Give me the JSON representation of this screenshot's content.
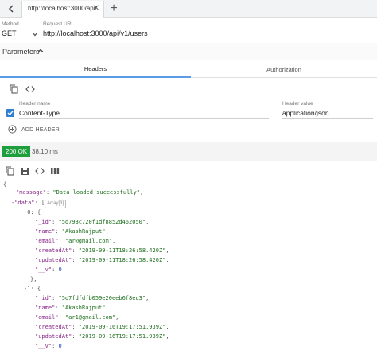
{
  "tab": {
    "title": "http://localhost:3000/api/..."
  },
  "request": {
    "method_label": "Method",
    "method": "GET",
    "url_label": "Request URL",
    "url": "http://localhost:3000/api/v1/users"
  },
  "parameters": {
    "label": "Parameters"
  },
  "subtabs": {
    "headers": "Headers",
    "authorization": "Authorization"
  },
  "headers_panel": {
    "name_label": "Header name",
    "value_label": "Header value",
    "rows": [
      {
        "name": "Content-Type",
        "value": "application/json",
        "enabled": true
      }
    ],
    "add_label": "ADD HEADER"
  },
  "response": {
    "status": "200 OK",
    "time": "38.10 ms",
    "json": {
      "open": "{",
      "message_key": "\"message\"",
      "message_value": "\"Data loaded successfully\"",
      "data_toggle": "-",
      "data_key": "\"data\"",
      "data_open": "[",
      "data_meta": "Array[3]",
      "items": [
        {
          "toggle": "-0:",
          "brace": "{",
          "id": "\"5d793c720f1df8852d462050\"",
          "name": "\"AkashRajput\"",
          "email": "\"ar@gmail.com\"",
          "createdAt": "\"2019-09-11T18:26:58.420Z\"",
          "updatedAt": "\"2019-09-11T18:26:58.420Z\"",
          "v": "0",
          "close": "},"
        },
        {
          "toggle": "-1:",
          "brace": "{",
          "id": "\"5d7fdfdfb059e20eeb6f8ed3\"",
          "name": "\"AkashRajput\"",
          "email": "\"ar1@gmail.com\"",
          "createdAt": "\"2019-09-16T19:17:51.939Z\"",
          "updatedAt": "\"2019-09-16T19:17:51.939Z\"",
          "v": "0",
          "close": "},"
        }
      ],
      "key_id": "\"_id\"",
      "key_name": "\"name\"",
      "key_email": "\"email\"",
      "key_createdAt": "\"createdAt\"",
      "key_updatedAt": "\"updatedAt\"",
      "key_v": "\"__v\""
    }
  },
  "colors": {
    "status_ok": "#1f9e3e",
    "checkbox": "#2f7fd6",
    "tab_indicator": "#5c9ce6"
  },
  "icons": [
    "back-arrow-icon",
    "close-icon",
    "plus-icon",
    "chevron-down-icon",
    "chevron-up-icon",
    "copy-icon",
    "code-icon",
    "add-circle-icon",
    "save-icon",
    "columns-icon"
  ]
}
